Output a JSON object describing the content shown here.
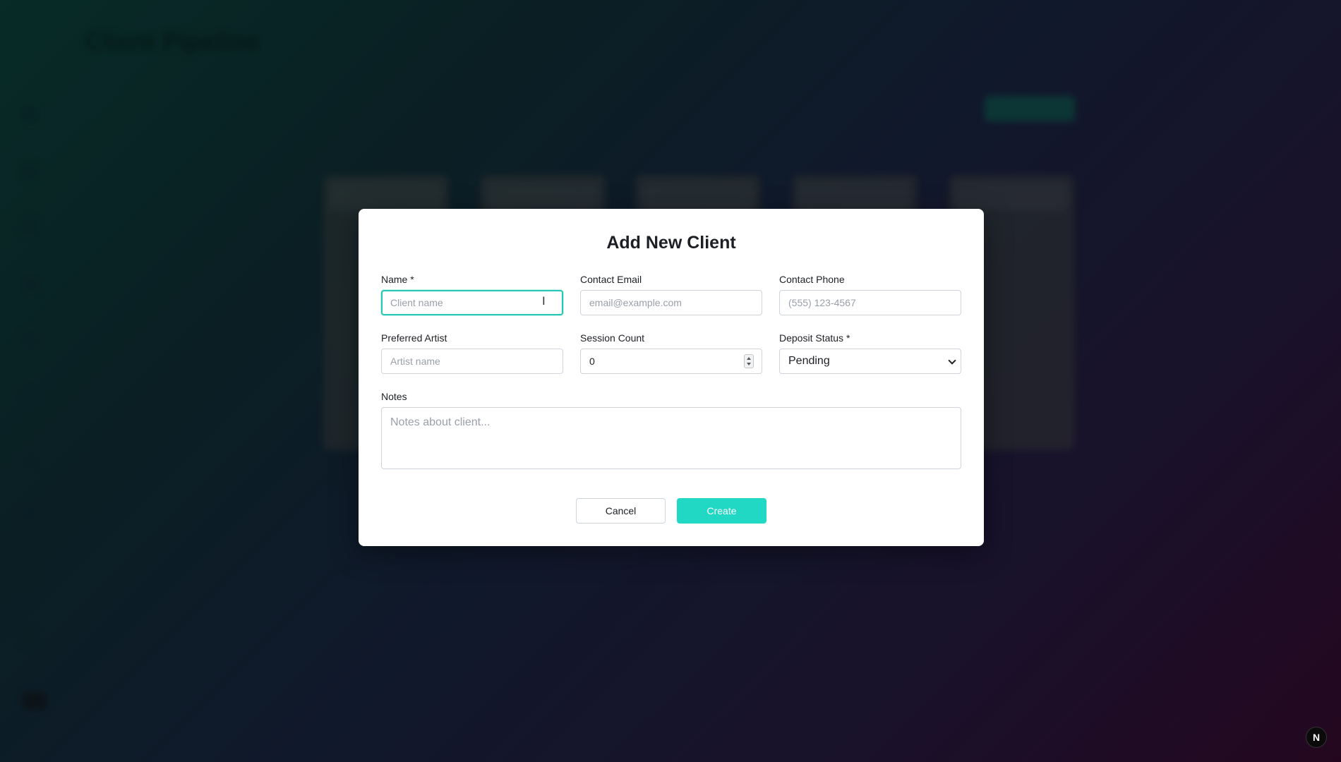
{
  "background": {
    "page_title": "Client Pipeline"
  },
  "modal": {
    "title": "Add New Client",
    "fields": {
      "name": {
        "label": "Name *",
        "placeholder": "Client name",
        "value": ""
      },
      "email": {
        "label": "Contact Email",
        "placeholder": "email@example.com",
        "value": ""
      },
      "phone": {
        "label": "Contact Phone",
        "placeholder": "(555) 123-4567",
        "value": ""
      },
      "artist": {
        "label": "Preferred Artist",
        "placeholder": "Artist name",
        "value": ""
      },
      "session_count": {
        "label": "Session Count",
        "value": "0"
      },
      "deposit_status": {
        "label": "Deposit Status *",
        "selected": "Pending"
      },
      "notes": {
        "label": "Notes",
        "placeholder": "Notes about client...",
        "value": ""
      }
    },
    "buttons": {
      "cancel": "Cancel",
      "create": "Create"
    }
  },
  "badge": {
    "letter": "N"
  },
  "colors": {
    "accent": "#21d8c4",
    "focus_border": "#24c9b5"
  }
}
